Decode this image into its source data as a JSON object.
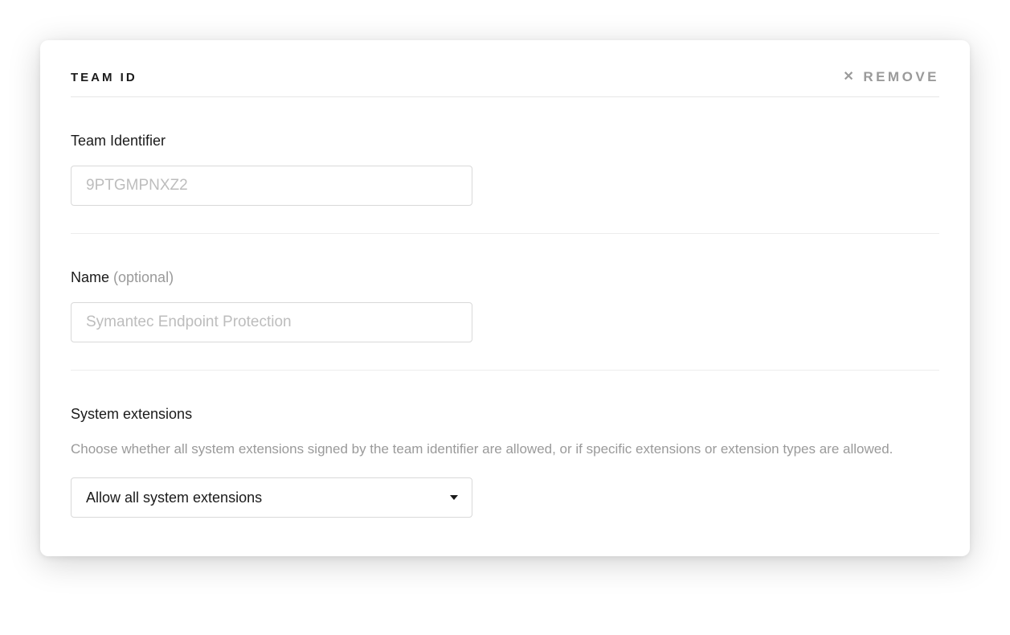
{
  "header": {
    "title": "TEAM ID",
    "remove_label": "Remove"
  },
  "team_identifier": {
    "label": "Team Identifier",
    "placeholder": "9PTGMPNXZ2",
    "value": ""
  },
  "name": {
    "label": "Name ",
    "optional_text": "(optional)",
    "placeholder": "Symantec Endpoint Protection",
    "value": ""
  },
  "system_extensions": {
    "label": "System extensions",
    "help": "Choose whether all system extensions signed by the team identifier are allowed, or if specific extensions or extension types are allowed.",
    "selected": "Allow all system extensions"
  }
}
